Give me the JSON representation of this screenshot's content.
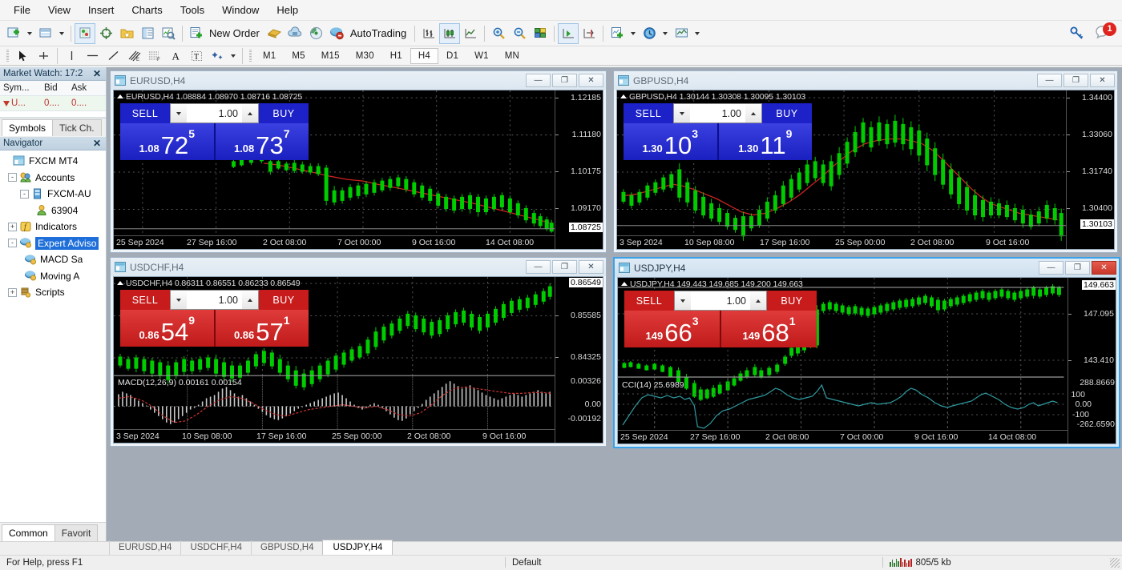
{
  "menu": {
    "items": [
      "File",
      "View",
      "Insert",
      "Charts",
      "Tools",
      "Window",
      "Help"
    ]
  },
  "toolbar": {
    "new_order_label": "New Order",
    "autotrading_label": "AutoTrading",
    "icons": [
      "new-chart-icon",
      "tile-windows-icon",
      "profiles-icon",
      "crosshair-icon",
      "favorites-icon",
      "data-window-icon",
      "strategy-tester-icon",
      "new-order-icon",
      "metaeditor-icon",
      "signals-icon",
      "autotrading-icon",
      "bar-chart-icon",
      "candlestick-chart-icon",
      "line-chart-icon",
      "zoom-in-icon",
      "zoom-out-icon",
      "tile-icon",
      "auto-scroll-icon",
      "chart-shift-icon",
      "indicators-icon",
      "period-icon",
      "templates-icon"
    ],
    "search_icon": "key-icon",
    "alerts_badge": "1"
  },
  "timeframes": {
    "items": [
      "M1",
      "M5",
      "M15",
      "M30",
      "H1",
      "H4",
      "D1",
      "W1",
      "MN"
    ],
    "selected": "H4"
  },
  "drawing_tools": [
    "cursor-icon",
    "crosshair-icon",
    "vertical-line-icon",
    "horizontal-line-icon",
    "trendline-icon",
    "equidistant-channel-icon",
    "fibonacci-icon",
    "text-icon",
    "text-label-icon",
    "shapes-icon"
  ],
  "market_watch": {
    "title": "Market Watch: 17:2",
    "close_icon": "close-icon",
    "headers": [
      "Sym...",
      "Bid",
      "Ask"
    ],
    "rows": [
      {
        "symbol": "U...",
        "bid": "0....",
        "ask": "0...."
      }
    ],
    "tabs": [
      {
        "label": "Symbols",
        "active": true
      },
      {
        "label": "Tick Ch.",
        "active": false
      }
    ]
  },
  "navigator": {
    "title": "Navigator",
    "close_icon": "close-icon",
    "tree": [
      {
        "label": "FXCM MT4",
        "indent": 0,
        "expander": "",
        "icon": "terminal-icon",
        "selected": false
      },
      {
        "label": "Accounts",
        "indent": 1,
        "expander": "-",
        "icon": "accounts-icon",
        "selected": false
      },
      {
        "label": "FXCM-AU",
        "indent": 2,
        "expander": "-",
        "icon": "server-icon",
        "selected": false
      },
      {
        "label": "63904",
        "indent": 3,
        "expander": "",
        "icon": "user-icon",
        "selected": false
      },
      {
        "label": "Indicators",
        "indent": 1,
        "expander": "+",
        "icon": "indicator-icon",
        "selected": false
      },
      {
        "label": "Expert Adviso",
        "indent": 1,
        "expander": "-",
        "icon": "expert-icon",
        "selected": true
      },
      {
        "label": "MACD Sa",
        "indent": 2,
        "expander": "",
        "icon": "expert-icon",
        "selected": false
      },
      {
        "label": "Moving A",
        "indent": 2,
        "expander": "",
        "icon": "expert-icon",
        "selected": false
      },
      {
        "label": "Scripts",
        "indent": 1,
        "expander": "+",
        "icon": "script-icon",
        "selected": false
      }
    ],
    "tabs": [
      {
        "label": "Common",
        "active": true
      },
      {
        "label": "Favorit",
        "active": false
      }
    ]
  },
  "chart_windows": [
    {
      "id": "eurusd",
      "title": "EURUSD,H4",
      "active": false,
      "window_buttons": [
        "minimize-icon",
        "maximize-icon",
        "close-icon"
      ],
      "trade_panel": {
        "color": "blue",
        "sell_label": "SELL",
        "buy_label": "BUY",
        "volume": "1.00",
        "sell_prefix": "1.08",
        "sell_big": "72",
        "sell_sup": "5",
        "buy_prefix": "1.08",
        "buy_big": "73",
        "buy_sup": "7"
      },
      "chart_data": {
        "type": "candlestick",
        "symbol": "EURUSD",
        "timeframe": "H4",
        "ohlc_label": "EURUSD,H4  1.08884 1.08970 1.08716 1.08725",
        "open": 1.08884,
        "high": 1.0897,
        "low": 1.08716,
        "close": 1.08725,
        "last_price": "1.08725",
        "y_ticks": [
          "1.12185",
          "1.11180",
          "1.10175",
          "1.09170"
        ],
        "ylim": [
          1.086,
          1.125
        ],
        "x_ticks": [
          "25 Sep 2024",
          "27 Sep 16:00",
          "2 Oct 08:00",
          "7 Oct 00:00",
          "9 Oct 16:00",
          "14 Oct 08:00"
        ],
        "overlay": "Moving Average (red)",
        "trend": "downtrend",
        "bull_color": "#00d000",
        "ma_color": "#cc2222",
        "grid": true,
        "indicators": []
      }
    },
    {
      "id": "gbpusd",
      "title": "GBPUSD,H4",
      "active": false,
      "window_buttons": [
        "minimize-icon",
        "maximize-icon",
        "close-icon"
      ],
      "trade_panel": {
        "color": "blue",
        "sell_label": "SELL",
        "buy_label": "BUY",
        "volume": "1.00",
        "sell_prefix": "1.30",
        "sell_big": "10",
        "sell_sup": "3",
        "buy_prefix": "1.30",
        "buy_big": "11",
        "buy_sup": "9"
      },
      "chart_data": {
        "type": "candlestick",
        "symbol": "GBPUSD",
        "timeframe": "H4",
        "ohlc_label": "GBPUSD,H4  1.30144 1.30308 1.30095 1.30103",
        "open": 1.30144,
        "high": 1.30308,
        "low": 1.30095,
        "close": 1.30103,
        "last_price": "1.30103",
        "y_ticks": [
          "1.34400",
          "1.33060",
          "1.31740",
          "1.30400"
        ],
        "ylim": [
          1.298,
          1.347
        ],
        "x_ticks": [
          "3 Sep 2024",
          "10 Sep 08:00",
          "17 Sep 16:00",
          "25 Sep 00:00",
          "2 Oct 08:00",
          "9 Oct 16:00"
        ],
        "overlay": "Moving Average (red)",
        "trend": "rise then decline",
        "bull_color": "#00d000",
        "ma_color": "#cc2222",
        "grid": true,
        "indicators": []
      }
    },
    {
      "id": "usdchf",
      "title": "USDCHF,H4",
      "active": false,
      "window_buttons": [
        "minimize-icon",
        "maximize-icon",
        "close-icon"
      ],
      "trade_panel": {
        "color": "red",
        "sell_label": "SELL",
        "buy_label": "BUY",
        "volume": "1.00",
        "sell_prefix": "0.86",
        "sell_big": "54",
        "sell_sup": "9",
        "buy_prefix": "0.86",
        "buy_big": "57",
        "buy_sup": "1"
      },
      "chart_data": {
        "type": "candlestick",
        "symbol": "USDCHF",
        "timeframe": "H4",
        "ohlc_label": "USDCHF,H4  0.86311 0.86551 0.86233 0.86549",
        "open": 0.86311,
        "high": 0.86551,
        "low": 0.86233,
        "close": 0.86549,
        "last_price": "0.86549",
        "y_ticks": [
          "0.86549",
          "0.85585",
          "0.84325"
        ],
        "ylim": [
          0.836,
          0.867
        ],
        "x_ticks": [
          "3 Sep 2024",
          "10 Sep 08:00",
          "17 Sep 16:00",
          "25 Sep 00:00",
          "2 Oct 08:00",
          "9 Oct 16:00"
        ],
        "overlay": "",
        "trend": "uptrend",
        "bull_color": "#00d000",
        "grid": true,
        "indicators": [
          {
            "name": "MACD",
            "label": "MACD(12,26,9) 0.00161 0.00154",
            "params": "12,26,9",
            "main": 0.00161,
            "signal": 0.00154,
            "y_ticks": [
              "0.00326",
              "0.00",
              "-0.00192"
            ],
            "ylim": [
              -0.00192,
              0.00326
            ],
            "histogram_color": "#c8c8c8",
            "signal_color": "#cc2222"
          }
        ]
      }
    },
    {
      "id": "usdjpy",
      "title": "USDJPY,H4",
      "active": true,
      "window_buttons": [
        "minimize-icon",
        "maximize-icon",
        "close-icon"
      ],
      "trade_panel": {
        "color": "red",
        "sell_label": "SELL",
        "buy_label": "BUY",
        "volume": "1.00",
        "sell_prefix": "149",
        "sell_big": "66",
        "sell_sup": "3",
        "buy_prefix": "149",
        "buy_big": "68",
        "buy_sup": "1"
      },
      "chart_data": {
        "type": "candlestick",
        "symbol": "USDJPY",
        "timeframe": "H4",
        "ohlc_label": "USDJPY,H4  149.443 149.685 149.200 149.663",
        "open": 149.443,
        "high": 149.685,
        "low": 149.2,
        "close": 149.663,
        "last_price": "149.663",
        "y_ticks": [
          "149.663",
          "147.095",
          "143.410"
        ],
        "ylim": [
          141.5,
          150.2
        ],
        "x_ticks": [
          "25 Sep 2024",
          "27 Sep 16:00",
          "2 Oct 08:00",
          "7 Oct 00:00",
          "9 Oct 16:00",
          "14 Oct 08:00"
        ],
        "overlay": "",
        "trend": "uptrend",
        "bull_color": "#00d000",
        "grid": true,
        "indicators": [
          {
            "name": "CCI",
            "label": "CCI(14) 25.6989",
            "params": "14",
            "value": 25.6989,
            "y_ticks": [
              "288.8669",
              "100",
              "0.00",
              "-100",
              "-262.6590"
            ],
            "ylim": [
              -262.659,
              288.8669
            ],
            "line_color": "#2f9aa0"
          }
        ]
      }
    }
  ],
  "chart_tabs": [
    {
      "label": "EURUSD,H4",
      "active": false
    },
    {
      "label": "USDCHF,H4",
      "active": false
    },
    {
      "label": "GBPUSD,H4",
      "active": false
    },
    {
      "label": "USDJPY,H4",
      "active": true
    }
  ],
  "status_bar": {
    "help_text": "For Help, press F1",
    "profile": "Default",
    "traffic": "805/5 kb",
    "traffic_icon": "network-traffic-icon",
    "resize_grip": "resize-grip-icon"
  }
}
